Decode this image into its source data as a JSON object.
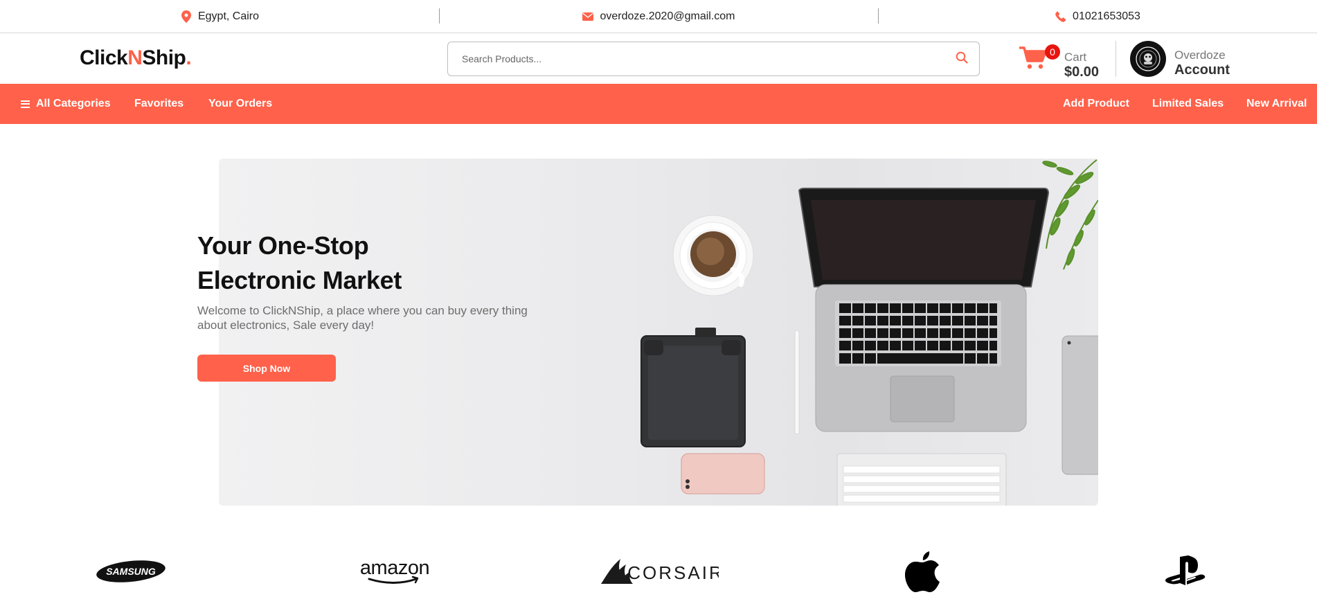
{
  "topbar": {
    "location": "Egypt, Cairo",
    "email": "overdoze.2020@gmail.com",
    "phone": "01021653053"
  },
  "header": {
    "logo_part1": "Click",
    "logo_part2": "N",
    "logo_part3": "Ship",
    "logo_dot": ".",
    "search_placeholder": "Search Products...",
    "cart_count": "0",
    "cart_label": "Cart",
    "cart_amount": "$0.00",
    "account_name": "Overdoze",
    "account_label": "Account"
  },
  "nav": {
    "left": [
      "All Categories",
      "Favorites",
      "Your Orders"
    ],
    "right": [
      "Add Product",
      "Limited Sales",
      "New Arrival"
    ]
  },
  "hero": {
    "title_line1": "Your One-Stop",
    "title_line2": "Electronic Market",
    "subtitle": "Welcome to ClickNShip, a place where you can buy every thing about electronics, Sale every day!",
    "button": "Shop Now"
  },
  "brands": {
    "samsung": "SAMSUNG",
    "amazon": "amazon",
    "corsair": "CORSAIR",
    "apple_icon": "apple-logo",
    "playstation_icon": "playstation-logo"
  },
  "colors": {
    "accent": "#ff614a",
    "badge": "#e8140f"
  }
}
